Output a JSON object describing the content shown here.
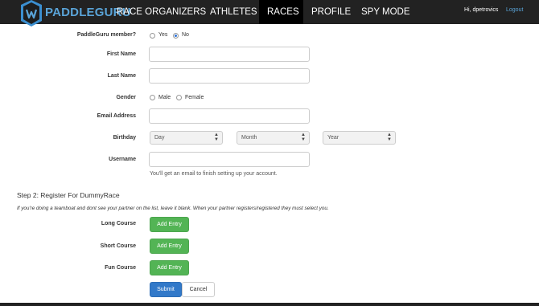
{
  "navbar": {
    "brand": "PADDLEGURU",
    "items": [
      {
        "label": "RACE ORGANIZERS"
      },
      {
        "label": "ATHLETES"
      },
      {
        "label": "RACES"
      },
      {
        "label": "PROFILE"
      },
      {
        "label": "SPY MODE"
      }
    ],
    "active_item": "RACES",
    "user_greeting": "Hi, dpetrovics",
    "logout_label": "Logout",
    "accent_color": "#5aa4d8"
  },
  "form": {
    "member": {
      "label": "PaddleGuru member?",
      "options": [
        "Yes",
        "No"
      ],
      "selected": "No"
    },
    "first_name": {
      "label": "First Name",
      "value": ""
    },
    "last_name": {
      "label": "Last Name",
      "value": ""
    },
    "gender": {
      "label": "Gender",
      "options": [
        "Male",
        "Female"
      ],
      "selected": ""
    },
    "email": {
      "label": "Email Address",
      "value": ""
    },
    "birthday": {
      "label": "Birthday",
      "day": "Day",
      "month": "Month",
      "year": "Year"
    },
    "username": {
      "label": "Username",
      "value": "",
      "help": "You'll get an email to finish setting up your account."
    }
  },
  "step2": {
    "title": "Step 2: Register For DummyRace",
    "note": "If you're doing a teamboat and dont see your partner on the list, leave it blank. When your partner registers/registered they must select you.",
    "courses": [
      {
        "label": "Long Course",
        "button": "Add Entry"
      },
      {
        "label": "Short Course",
        "button": "Add Entry"
      },
      {
        "label": "Fun Course",
        "button": "Add Entry"
      }
    ],
    "add_button_color": "#53b455"
  },
  "actions": {
    "submit_label": "Submit",
    "cancel_label": "Cancel",
    "submit_color": "#3279c9"
  }
}
